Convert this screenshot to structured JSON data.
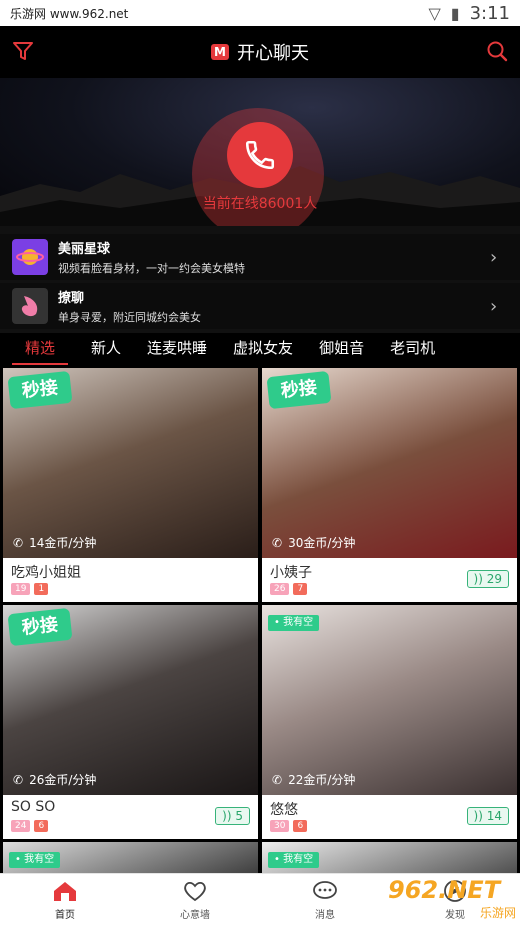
{
  "status_bar": {
    "site": "乐游网 www.962.net",
    "time": "3:11"
  },
  "header": {
    "title": "开心聊天",
    "logo_letter": "M"
  },
  "hero": {
    "online_text": "当前在线86001人"
  },
  "promos": [
    {
      "title": "美丽星球",
      "subtitle": "视频看脸看身材，一对一约会美女模特"
    },
    {
      "title": "撩聊",
      "subtitle": "单身寻爱，附近同城约会美女"
    }
  ],
  "tabs": [
    {
      "label": "精选",
      "active": true
    },
    {
      "label": "新人"
    },
    {
      "label": "连麦哄睡"
    },
    {
      "label": "虚拟女友"
    },
    {
      "label": "御姐音"
    },
    {
      "label": "老司机"
    }
  ],
  "cards": [
    {
      "name": "吃鸡小姐姐",
      "price": "14金币/分钟",
      "stamp": "秒接",
      "badge1": "19",
      "badge2": "1",
      "likes": ""
    },
    {
      "name": "小姨子",
      "price": "30金币/分钟",
      "stamp": "秒接",
      "badge1": "26",
      "badge2": "7",
      "likes": "29"
    },
    {
      "name": "SO SO",
      "price": "26金币/分钟",
      "stamp": "秒接",
      "badge1": "24",
      "badge2": "6",
      "likes": "5"
    },
    {
      "name": "悠悠",
      "price": "22金币/分钟",
      "tag": "• 我有空",
      "badge1": "30",
      "badge2": "6",
      "likes": "14"
    },
    {
      "tag": "• 我有空"
    },
    {
      "tag": "• 我有空"
    }
  ],
  "bottom_nav": [
    {
      "label": "首页",
      "icon": "home-icon",
      "active": true
    },
    {
      "label": "心意墙",
      "icon": "heart-icon"
    },
    {
      "label": "消息",
      "icon": "message-icon"
    },
    {
      "label": "发现",
      "icon": "compass-icon"
    }
  ],
  "watermark": {
    "text": "962.NET",
    "subtext": "乐游网"
  },
  "colors": {
    "accent": "#e5393c",
    "green": "#2fcb8b",
    "background": "#000000"
  }
}
